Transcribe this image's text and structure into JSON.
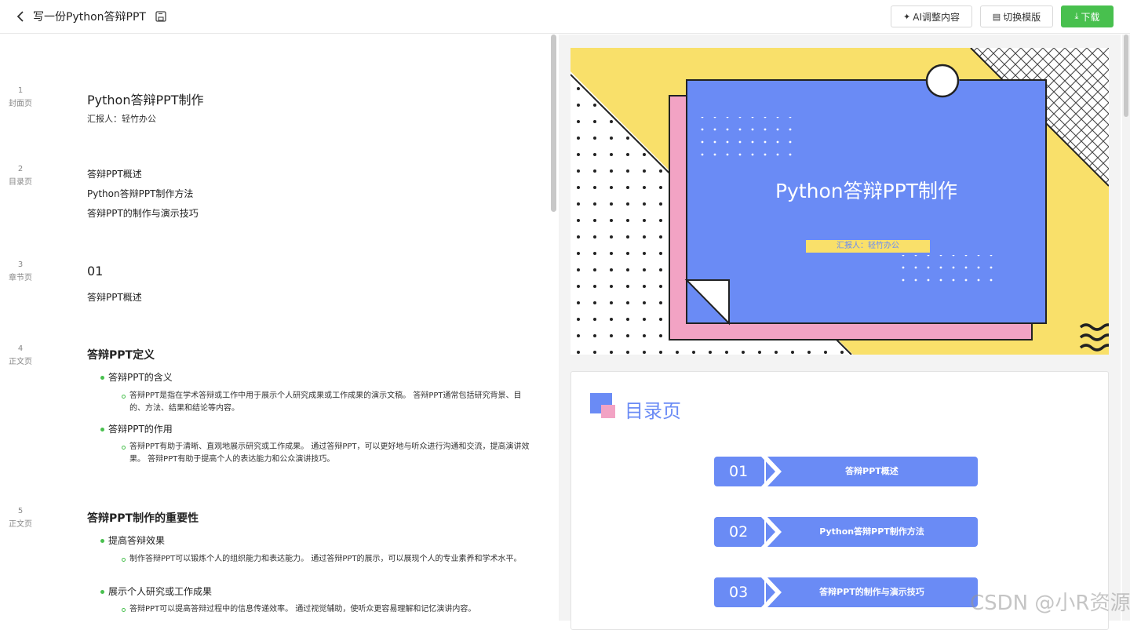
{
  "header": {
    "title": "写一份Python答辩PPT",
    "ai_button": "AI调整内容",
    "template_button": "切换模版",
    "download_button": "下载"
  },
  "outline": {
    "pages": [
      {
        "no": "1",
        "type": "封面页"
      },
      {
        "no": "2",
        "type": "目录页"
      },
      {
        "no": "3",
        "type": "章节页"
      },
      {
        "no": "4",
        "type": "正文页"
      },
      {
        "no": "5",
        "type": "正文页"
      }
    ],
    "cover": {
      "title": "Python答辩PPT制作",
      "reporter": "汇报人：轻竹办公"
    },
    "toc": [
      "答辩PPT概述",
      "Python答辩PPT制作方法",
      "答辩PPT的制作与演示技巧"
    ],
    "chapter": {
      "number": "01",
      "title": "答辩PPT概述"
    },
    "p4": {
      "heading": "答辩PPT定义",
      "b1": "答辩PPT的含义",
      "b1_detail": "答辩PPT是指在学术答辩或工作中用于展示个人研究成果或工作成果的演示文稿。 答辩PPT通常包括研究背景、目的、方法、结果和结论等内容。",
      "b2": "答辩PPT的作用",
      "b2_detail": "答辩PPT有助于清晰、直观地展示研究或工作成果。 通过答辩PPT，可以更好地与听众进行沟通和交流，提高演讲效果。 答辩PPT有助于提高个人的表达能力和公众演讲技巧。"
    },
    "p5": {
      "heading": "答辩PPT制作的重要性",
      "b1": "提高答辩效果",
      "b1_detail": "制作答辩PPT可以锻炼个人的组织能力和表达能力。 通过答辩PPT的展示，可以展现个人的专业素养和学术水平。",
      "b2": "展示个人研究或工作成果",
      "b2_detail": "答辩PPT可以提高答辩过程中的信息传递效率。 通过视觉辅助，使听众更容易理解和记忆演讲内容。"
    }
  },
  "preview": {
    "slide1": {
      "title": "Python答辩PPT制作",
      "reporter": "汇报人：轻竹办公"
    },
    "slide2": {
      "title": "目录页",
      "items": [
        {
          "num": "01",
          "label": "答辩PPT概述"
        },
        {
          "num": "02",
          "label": "Python答辩PPT制作方法"
        },
        {
          "num": "03",
          "label": "答辩PPT的制作与演示技巧"
        }
      ]
    },
    "colors": {
      "blue": "#6a8bf5",
      "yellow": "#f9e06a",
      "pink": "#f2a3c4",
      "green": "#48c04e"
    }
  },
  "watermark": "CSDN @小R资源"
}
